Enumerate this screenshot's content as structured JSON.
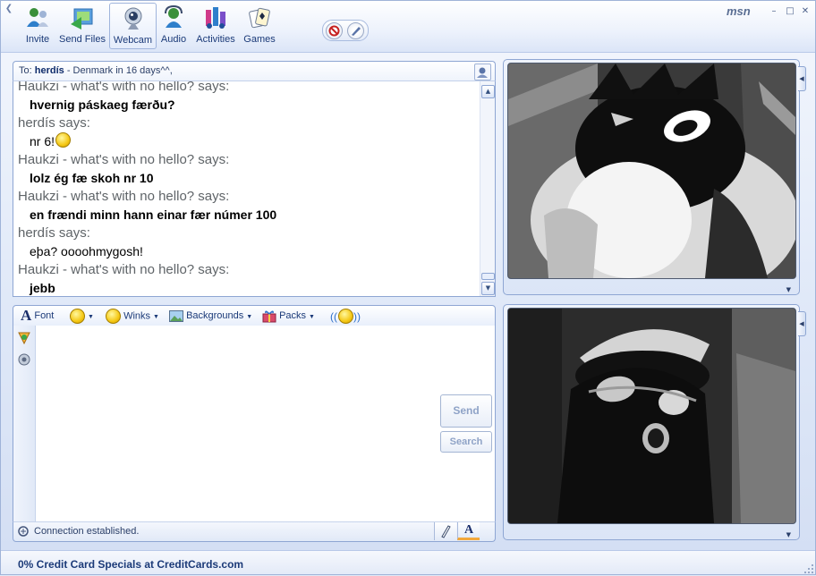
{
  "window": {
    "logo": "msn",
    "controls": {
      "minimize": "–",
      "maximize": "□",
      "close": "✕"
    }
  },
  "toolbar": {
    "buttons": [
      {
        "label": "Invite",
        "icon": "invite-icon"
      },
      {
        "label": "Send Files",
        "icon": "send-files-icon"
      },
      {
        "label": "Webcam",
        "icon": "webcam-icon",
        "active": true
      },
      {
        "label": "Audio",
        "icon": "audio-icon"
      },
      {
        "label": "Activities",
        "icon": "activities-icon"
      },
      {
        "label": "Games",
        "icon": "games-icon"
      }
    ],
    "block_icon": "block-icon",
    "paint_icon": "display-picture-icon"
  },
  "conversation": {
    "to_prefix": "To:",
    "contact_name": "herdís",
    "contact_status": "- Denmark in 16 days^^,",
    "messages": [
      {
        "sender": "Haukzi - what's with no hello? says:",
        "text": "hvernig páskaeg færðu?",
        "bold": true
      },
      {
        "sender": "herdís says:",
        "text": "nr 6!",
        "emoticon": "smile-icon",
        "bold": false
      },
      {
        "sender": "Haukzi - what's with no hello? says:",
        "text": "lolz ég fæ skoh nr 10",
        "bold": true
      },
      {
        "sender": "Haukzi - what's with no hello? says:",
        "text": "en frændi minn hann einar fær númer 100",
        "bold": true
      },
      {
        "sender": "herdís says:",
        "text": "eþa? oooohmygosh!",
        "bold": false
      },
      {
        "sender": "Haukzi - what's with no hello? says:",
        "text": "jebb",
        "bold": true
      }
    ]
  },
  "format_bar": {
    "font_label": "Font",
    "winks_label": "Winks",
    "backgrounds_label": "Backgrounds",
    "packs_label": "Packs"
  },
  "compose": {
    "input_value": "",
    "send_label": "Send",
    "search_label": "Search"
  },
  "status": {
    "text": "Connection established."
  },
  "footer": {
    "ad_text": "0% Credit Card Specials at CreditCards.com"
  },
  "colors": {
    "accent": "#1b3a78",
    "panel_border": "#8ea6d3",
    "sender_gray": "#5f6468"
  }
}
